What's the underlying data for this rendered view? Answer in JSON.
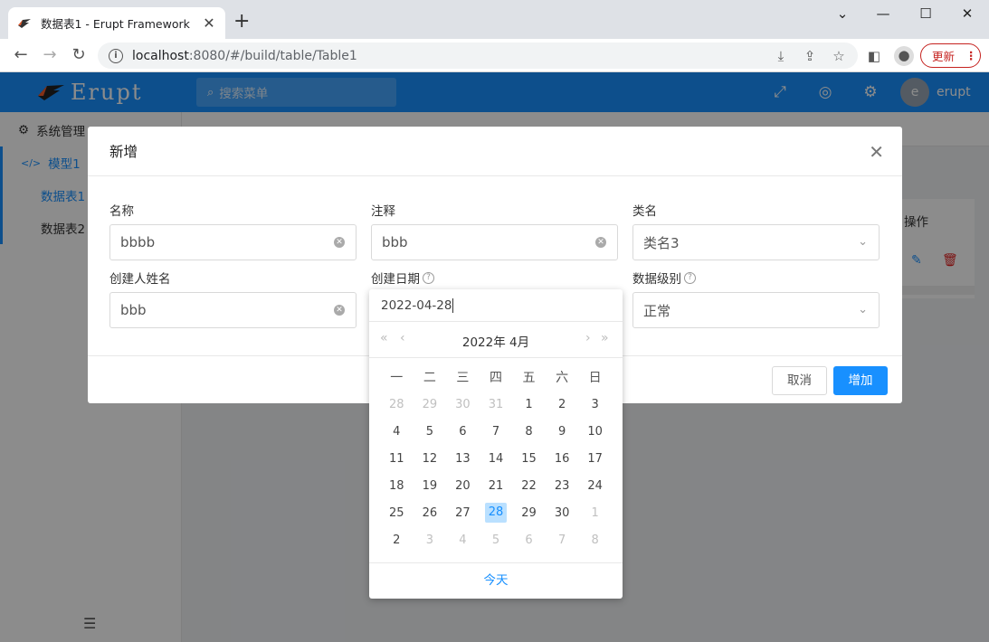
{
  "browser": {
    "tab_title": "数据表1 - Erupt Framework",
    "url_host": "localhost",
    "url_path": ":8080/#/build/table/Table1",
    "update_label": "更新"
  },
  "app": {
    "logo_text": "Erupt",
    "search_placeholder": "搜索菜单",
    "avatar_letter": "e",
    "username": "erupt",
    "accent_color": "#1890ff"
  },
  "sidebar": {
    "items": [
      {
        "label": "系统管理"
      },
      {
        "label": "模型1"
      },
      {
        "label": "数据表1"
      },
      {
        "label": "数据表2"
      }
    ]
  },
  "content": {
    "operations_header": "操作"
  },
  "modal": {
    "title": "新增",
    "fields": {
      "name": {
        "label": "名称",
        "value": "bbbb"
      },
      "comment": {
        "label": "注释",
        "value": "bbb"
      },
      "class_name": {
        "label": "类名",
        "value": "类名3"
      },
      "creator": {
        "label": "创建人姓名",
        "value": "bbb"
      },
      "created_date": {
        "label": "创建日期",
        "value": "2022-04-28"
      },
      "level": {
        "label": "数据级别",
        "value": "正常"
      }
    },
    "cancel_label": "取消",
    "add_label": "增加"
  },
  "datepicker": {
    "input_value": "2022-04-28",
    "month_label": "2022年 4月",
    "weekdays": [
      "一",
      "二",
      "三",
      "四",
      "五",
      "六",
      "日"
    ],
    "weeks": [
      [
        [
          "28",
          true
        ],
        [
          "29",
          true
        ],
        [
          "30",
          true
        ],
        [
          "31",
          true
        ],
        [
          "1",
          false
        ],
        [
          "2",
          false
        ],
        [
          "3",
          false
        ]
      ],
      [
        [
          "4",
          false
        ],
        [
          "5",
          false
        ],
        [
          "6",
          false
        ],
        [
          "7",
          false
        ],
        [
          "8",
          false
        ],
        [
          "9",
          false
        ],
        [
          "10",
          false
        ]
      ],
      [
        [
          "11",
          false
        ],
        [
          "12",
          false
        ],
        [
          "13",
          false
        ],
        [
          "14",
          false
        ],
        [
          "15",
          false
        ],
        [
          "16",
          false
        ],
        [
          "17",
          false
        ]
      ],
      [
        [
          "18",
          false
        ],
        [
          "19",
          false
        ],
        [
          "20",
          false
        ],
        [
          "21",
          false
        ],
        [
          "22",
          false
        ],
        [
          "23",
          false
        ],
        [
          "24",
          false
        ]
      ],
      [
        [
          "25",
          false
        ],
        [
          "26",
          false
        ],
        [
          "27",
          false
        ],
        [
          "28",
          false
        ],
        [
          "29",
          false
        ],
        [
          "30",
          false
        ],
        [
          "1",
          true
        ]
      ],
      [
        [
          "2",
          false
        ],
        [
          "3",
          true
        ],
        [
          "4",
          true
        ],
        [
          "5",
          true
        ],
        [
          "6",
          true
        ],
        [
          "7",
          true
        ],
        [
          "8",
          true
        ]
      ]
    ],
    "selected_day": "28",
    "today_label": "今天"
  }
}
